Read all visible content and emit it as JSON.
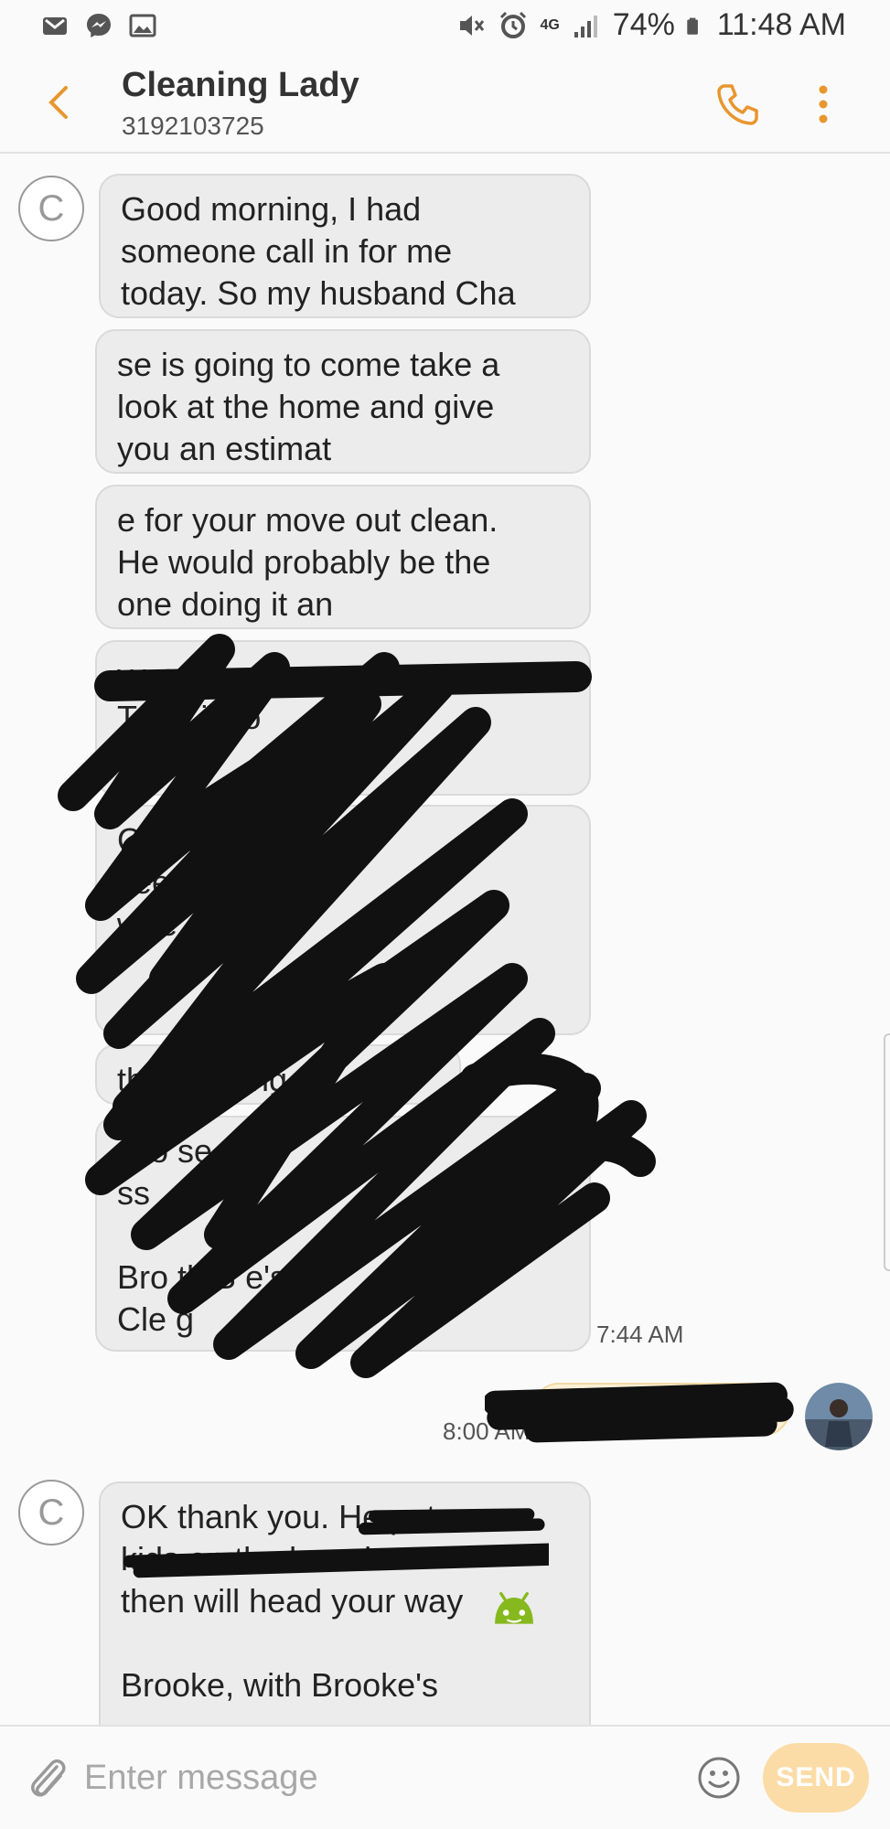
{
  "status_bar": {
    "battery": "74%",
    "time": "11:48 AM",
    "network": "4G",
    "icons_left": [
      "gmail-icon",
      "messenger-icon",
      "gallery-icon"
    ],
    "icons_right": [
      "mute-icon",
      "alarm-icon",
      "signal-icon",
      "battery-icon"
    ]
  },
  "header": {
    "title": "Cleaning Lady",
    "subtitle": "3192103725"
  },
  "messages": {
    "contact_initial": "C",
    "m1": "Good morning, I had\nsomeone call in for me\ntoday. So my husband Cha",
    "m2": "se is going to come take a\nlook at the home and give\nyou an estimat",
    "m3": "e for your move out clean.\nHe would probably be the\none doing it an",
    "m4": "y      you'\nT  o     d if yo\nre",
    "m5": "C  o  e       l\nsee  if  are  co\nwhe\n\n   ,  w",
    "m6": "th B     s C   ing",
    "m7": "C   o    se r      me\n          ss\n\nBro      th B     e's\nCle      g",
    "time_group1": "7:44 AM",
    "out_text": "e he",
    "time_out": "8:00 AM",
    "m8": "OK thank you. He puts our\nkids on the b          and\nthen will head your way\n\nBrooke, with Brooke's"
  },
  "composer": {
    "placeholder": "Enter message",
    "send_label": "SEND"
  },
  "colors": {
    "accent": "#e8962e",
    "bubble_in": "#ececec",
    "bubble_out": "#fdf0d4",
    "send_button": "#fbdca6",
    "emoji_green": "#86b91e"
  }
}
